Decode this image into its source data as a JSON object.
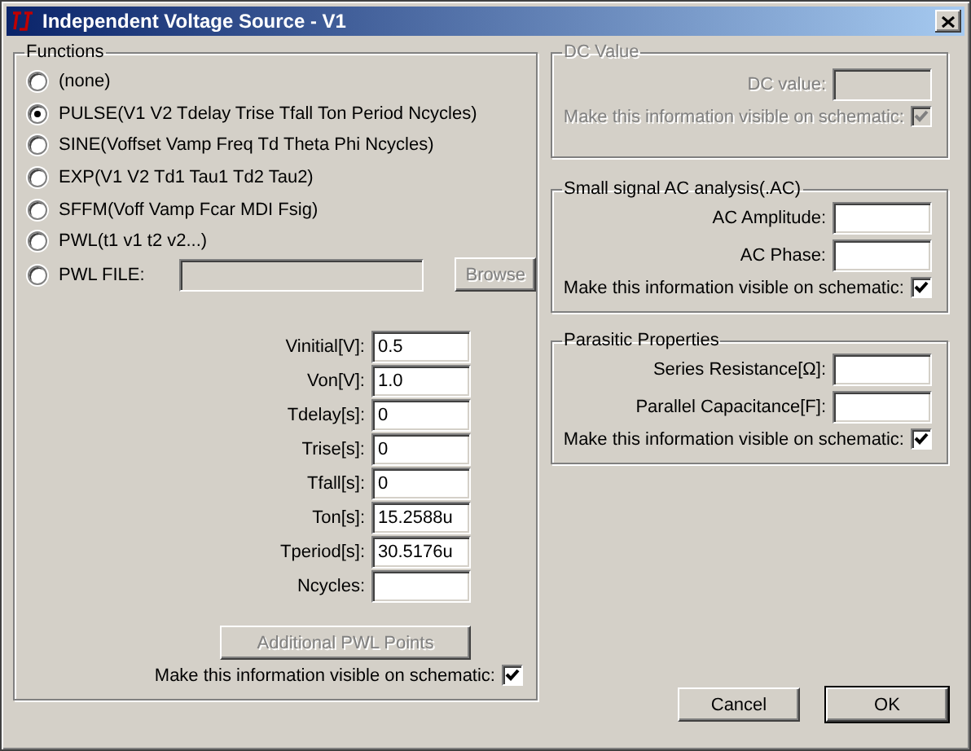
{
  "window": {
    "title": "Independent Voltage Source - V1"
  },
  "functions": {
    "title": "Functions",
    "options": [
      {
        "label": "(none)",
        "selected": false,
        "kind": "plain"
      },
      {
        "label": "PULSE(V1 V2 Tdelay Trise Tfall Ton Period Ncycles)",
        "selected": true,
        "kind": "plain"
      },
      {
        "label": "SINE(Voffset Vamp Freq Td Theta Phi Ncycles)",
        "selected": false,
        "kind": "plain"
      },
      {
        "label": "EXP(V1 V2 Td1 Tau1 Td2 Tau2)",
        "selected": false,
        "kind": "plain"
      },
      {
        "label": "SFFM(Voff Vamp Fcar MDI Fsig)",
        "selected": false,
        "kind": "plain"
      },
      {
        "label": "PWL(t1 v1 t2 v2...)",
        "selected": false,
        "kind": "plain"
      },
      {
        "label": "PWL FILE:",
        "selected": false,
        "kind": "file",
        "field_disabled": true,
        "browse": {
          "label": "Browse",
          "disabled": true
        }
      }
    ],
    "parameters": [
      {
        "label": "Vinitial[V]:",
        "value": "0.5"
      },
      {
        "label": "Von[V]:",
        "value": "1.0"
      },
      {
        "label": "Tdelay[s]:",
        "value": "0"
      },
      {
        "label": "Trise[s]:",
        "value": "0"
      },
      {
        "label": "Tfall[s]:",
        "value": "0"
      },
      {
        "label": "Ton[s]:",
        "value": "15.2588u"
      },
      {
        "label": "Tperiod[s]:",
        "value": "30.5176u"
      },
      {
        "label": "Ncycles:"
      }
    ],
    "additional_button": {
      "label": "Additional PWL Points",
      "disabled": true
    },
    "visible": {
      "label": "Make this information visible on schematic:",
      "checked": true,
      "disabled": false
    }
  },
  "groups": [
    {
      "title": "DC Value",
      "disabled": true,
      "fields": [
        {
          "label": "DC value:"
        }
      ],
      "visible": {
        "label": "Make this information visible on schematic:",
        "checked": true,
        "disabled": true
      }
    },
    {
      "title": "Small signal AC analysis(.AC)",
      "disabled": false,
      "fields": [
        {
          "label": "AC Amplitude:"
        },
        {
          "label": "AC Phase:"
        }
      ],
      "visible": {
        "label": "Make this information visible on schematic:",
        "checked": true,
        "disabled": false
      }
    },
    {
      "title": "Parasitic Properties",
      "disabled": false,
      "fields": [
        {
          "label": "Series Resistance[Ω]:"
        },
        {
          "label": "Parallel Capacitance[F]:"
        }
      ],
      "visible": {
        "label": "Make this information visible on schematic:",
        "checked": true,
        "disabled": false
      }
    }
  ],
  "buttons": [
    {
      "label": "Cancel",
      "default": false
    },
    {
      "label": "OK",
      "default": true
    }
  ]
}
